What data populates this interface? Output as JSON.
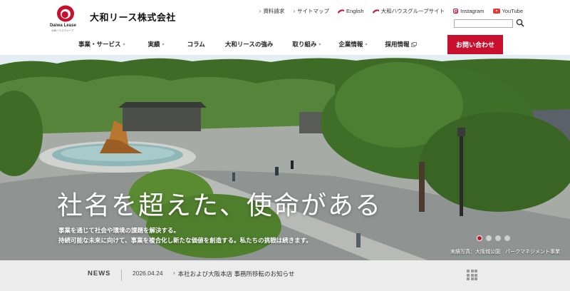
{
  "brand": {
    "logo_text": "Daiwa Lease",
    "logo_sub": "大和ハウスグループ",
    "company_name": "大和リース株式会社",
    "accent_color": "#c8102e"
  },
  "util_links": [
    {
      "label": "資料請求",
      "icon": "chevron-right-icon"
    },
    {
      "label": "サイトマップ",
      "icon": "chevron-right-icon"
    },
    {
      "label": "English",
      "icon": "daiwa-logo-icon"
    },
    {
      "label": "大和ハウスグループサイト",
      "icon": "daiwa-logo-icon"
    },
    {
      "label": "Instagram",
      "icon": "instagram-icon"
    },
    {
      "label": "YouTube",
      "icon": "youtube-icon"
    }
  ],
  "search": {
    "placeholder": "",
    "value": ""
  },
  "nav": [
    {
      "label": "事業・サービス",
      "caret": true
    },
    {
      "label": "実績",
      "caret": true
    },
    {
      "label": "コラム",
      "caret": false
    },
    {
      "label": "大和リースの強み",
      "caret": false
    },
    {
      "label": "取り組み",
      "caret": true
    },
    {
      "label": "企業情報",
      "caret": true
    },
    {
      "label": "採用情報",
      "caret": false,
      "external": true
    }
  ],
  "contact_label": "お問い合わせ",
  "hero": {
    "title": "社名を超えた、使命がある",
    "desc_line1": "事業を通じて社会や環境の課題を解決する。",
    "desc_line2": "持続可能な未来に向けて、事業を複合化し新たな価値を創造する。私たちの挑戦は続きます。",
    "caption": "実績写真：大阪城公園　パークマネジメント事業",
    "slide_count": 4,
    "active_slide": 1
  },
  "news": {
    "label": "NEWS",
    "date": "2026.04.24",
    "title": "本社および大阪本店 事務所移転のお知らせ"
  }
}
